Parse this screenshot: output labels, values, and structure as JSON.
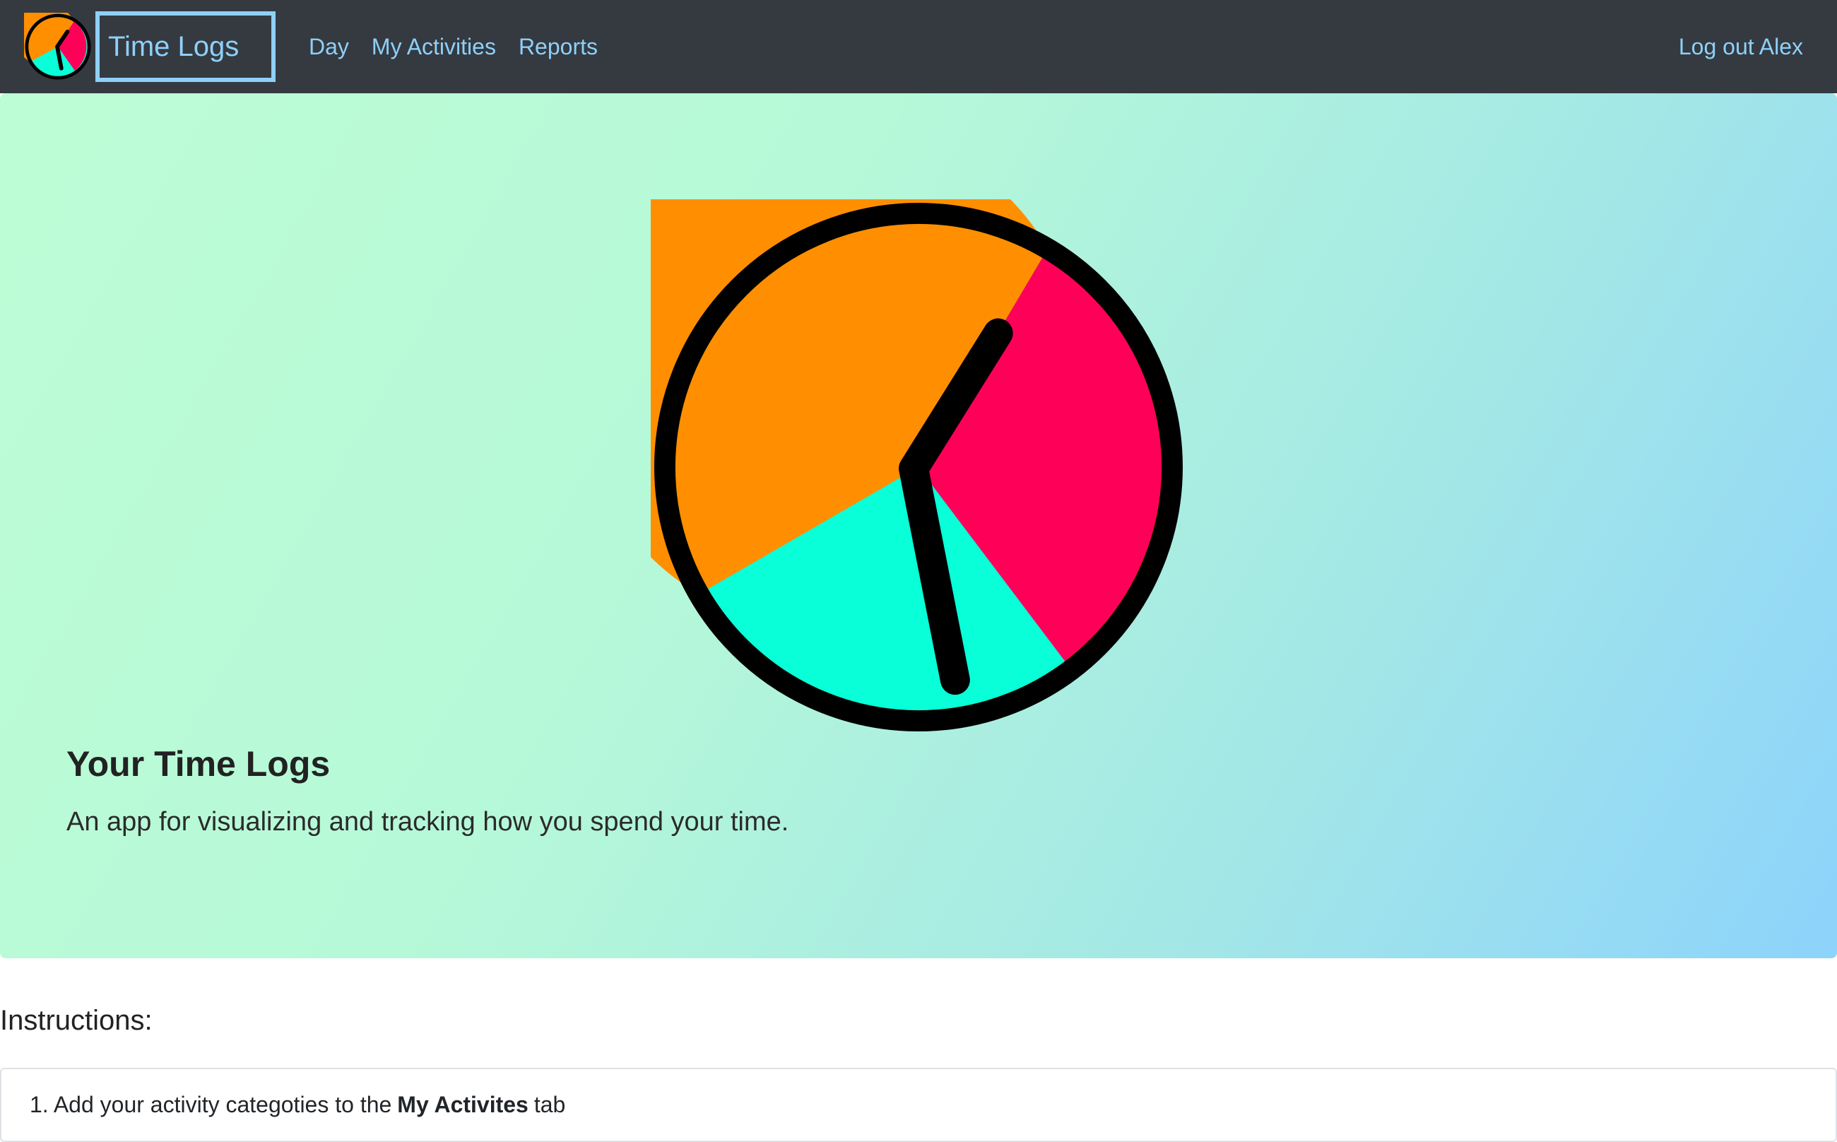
{
  "navbar": {
    "brand": "Time Logs",
    "links": [
      "Day",
      "My Activities",
      "Reports"
    ],
    "logout": "Log out Alex"
  },
  "hero": {
    "title": "Your Time Logs",
    "subtitle": "An app for visualizing and tracking how you spend your time."
  },
  "instructions": {
    "heading": "Instructions:",
    "items": [
      {
        "prefix": "1. Add your activity categoties to the",
        "emphasis": "My Activites",
        "suffix": "tab"
      }
    ]
  },
  "logo": {
    "icon": "clock-pie-icon",
    "colors": {
      "orange": "#ff8f00",
      "pink": "#ff0059",
      "teal": "#08ffd8",
      "ring": "#000000"
    }
  },
  "theme": {
    "navbar_bg": "#343a40",
    "link_color": "#8fd0f9",
    "hero_gradient": [
      "#bdfdd5",
      "#8dd3fb"
    ]
  }
}
